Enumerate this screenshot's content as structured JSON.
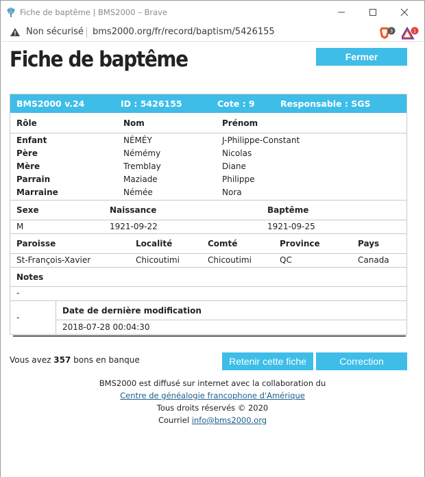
{
  "window": {
    "title": "Fiche de baptême | BMS2000 – Brave"
  },
  "addressbar": {
    "security": "Non sécurisé",
    "url": "bms2000.org/fr/record/baptism/5426155",
    "shields_count": "3",
    "rewards_count": "1"
  },
  "page": {
    "title": "Fiche de baptême",
    "close_label": "Fermer"
  },
  "record": {
    "version": "BMS2000 v.24",
    "id": "ID : 5426155",
    "cote": "Cote : 9",
    "responsable": "Responsable : SGS",
    "people_headers": [
      "Rôle",
      "Nom",
      "Prénom"
    ],
    "people": [
      {
        "role": "Enfant",
        "nom": "NÉMÉY",
        "prenom": "J-Philippe-Constant"
      },
      {
        "role": "Père",
        "nom": "Némémy",
        "prenom": "Nicolas"
      },
      {
        "role": "Mère",
        "nom": "Tremblay",
        "prenom": "Diane"
      },
      {
        "role": "Parrain",
        "nom": "Maziade",
        "prenom": "Philippe"
      },
      {
        "role": "Marraine",
        "nom": "Némée",
        "prenom": "Nora"
      }
    ],
    "dates_headers": [
      "Sexe",
      "Naissance",
      "Baptême"
    ],
    "dates": {
      "sexe": "M",
      "naissance": "1921-09-22",
      "bapteme": "1921-09-25"
    },
    "place_headers": [
      "Paroisse",
      "Localité",
      "Comté",
      "Province",
      "Pays"
    ],
    "place": {
      "paroisse": "St-François-Xavier",
      "localite": "Chicoutimi",
      "comte": "Chicoutimi",
      "province": "QC",
      "pays": "Canada"
    },
    "notes_header": "Notes",
    "notes": "-",
    "modif_left": "-",
    "modif_header": "Date de dernière modification",
    "modif_value": "2018-07-28 00:04:30"
  },
  "bank": {
    "prefix": "Vous avez ",
    "count": "357",
    "suffix": " bons en banque"
  },
  "actions": {
    "retain_label": "Retenir cette fiche",
    "correct_label": "Correction"
  },
  "footer": {
    "line1": "BMS2000 est diffusé sur internet avec la collaboration du",
    "link1": "Centre de généalogie francophone d'Amérique",
    "line3": "Tous droits réservés © 2020",
    "line4_prefix": "Courriel ",
    "email": "info@bms2000.org"
  },
  "colors": {
    "accent": "#3ebde8",
    "link": "#1a5d8a"
  }
}
